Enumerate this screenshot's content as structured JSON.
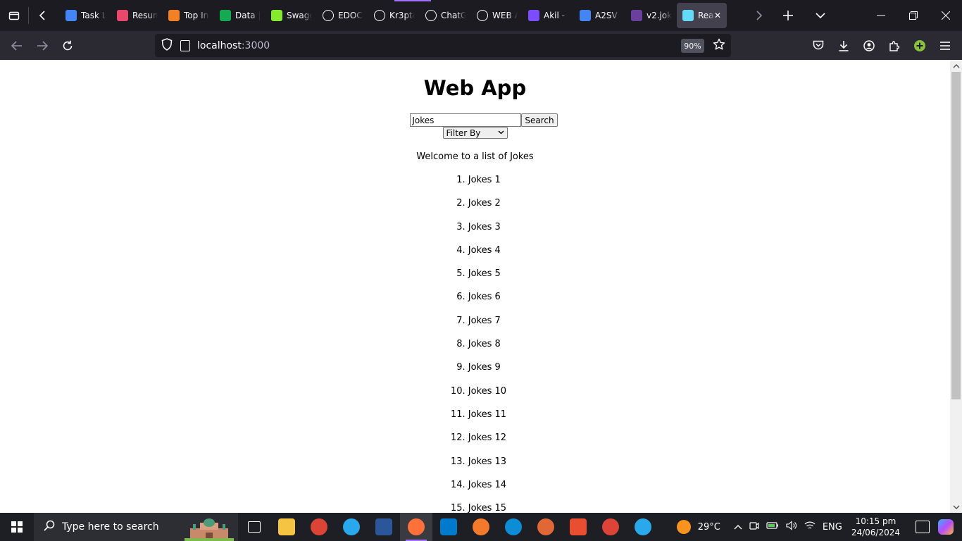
{
  "browser": {
    "tabs": [
      {
        "title": "Task L",
        "icon": "google-docs-icon",
        "color": "#4285f4"
      },
      {
        "title": "Resum",
        "icon": "resume-icon",
        "color": "#e8486b"
      },
      {
        "title": "Top In",
        "icon": "stackoverflow-icon",
        "color": "#f48024"
      },
      {
        "title": "Data |",
        "icon": "mongodb-icon",
        "color": "#13aa52"
      },
      {
        "title": "Swagg",
        "icon": "swagger-icon",
        "color": "#85ea2d"
      },
      {
        "title": "EDOC",
        "icon": "github-icon",
        "color": "#ffffff"
      },
      {
        "title": "Kr3ptc",
        "icon": "github-icon",
        "color": "#ffffff"
      },
      {
        "title": "ChatG",
        "icon": "chatgpt-icon",
        "color": "#ffffff"
      },
      {
        "title": "WEB A",
        "icon": "chatgpt-icon",
        "color": "#ffffff"
      },
      {
        "title": "Akil -",
        "icon": "akil-icon",
        "color": "#7c4dff"
      },
      {
        "title": "A2SV",
        "icon": "google-docs-icon",
        "color": "#4285f4"
      },
      {
        "title": "v2.jok",
        "icon": "jokes-icon",
        "color": "#6b3fa0"
      },
      {
        "title": "Rea",
        "icon": "react-icon",
        "color": "#61dafb",
        "active": true
      }
    ],
    "url_host": "localhost",
    "url_port": ":3000",
    "zoom": "90%"
  },
  "page": {
    "title": "Web App",
    "search": {
      "value": "Jokes",
      "button": "Search"
    },
    "filter": {
      "selected": "Filter By"
    },
    "welcome": "Welcome to a list of Jokes",
    "jokes": [
      "1. Jokes 1",
      "2. Jokes 2",
      "3. Jokes 3",
      "4. Jokes 4",
      "5. Jokes 5",
      "6. Jokes 6",
      "7. Jokes 7",
      "8. Jokes 8",
      "9. Jokes 9",
      "10. Jokes 10",
      "11. Jokes 11",
      "12. Jokes 12",
      "13. Jokes 13",
      "14. Jokes 14",
      "15. Jokes 15"
    ]
  },
  "taskbar": {
    "search_placeholder": "Type here to search",
    "weather": "29°C",
    "language": "ENG",
    "time": "10:15 pm",
    "date": "24/06/2024",
    "apps": [
      {
        "name": "task-view-icon",
        "color": "#1e1f24"
      },
      {
        "name": "file-explorer-icon",
        "color": "#f5c542"
      },
      {
        "name": "chrome-icon",
        "color": "#db4437"
      },
      {
        "name": "telegram-icon",
        "color": "#29a9eb"
      },
      {
        "name": "word-icon",
        "color": "#2b579a"
      },
      {
        "name": "firefox-icon",
        "color": "#ff7139",
        "active": true
      },
      {
        "name": "vscode-icon",
        "color": "#007acc"
      },
      {
        "name": "blender-icon",
        "color": "#f5792a"
      },
      {
        "name": "edge-icon",
        "color": "#0c8dd6"
      },
      {
        "name": "matlab-icon",
        "color": "#e16737"
      },
      {
        "name": "git-icon",
        "color": "#e94e31"
      },
      {
        "name": "chrome-profile-icon",
        "color": "#db4437"
      },
      {
        "name": "telegram-notif-icon",
        "color": "#29a9eb"
      }
    ]
  }
}
